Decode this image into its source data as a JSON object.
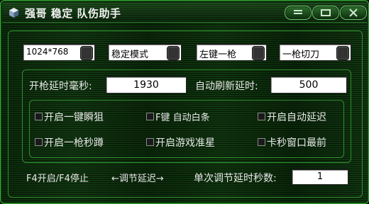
{
  "window": {
    "title": "强哥 稳定 队伤助手",
    "buttons": [
      "menu-icon",
      "minimize-icon",
      "close-icon"
    ]
  },
  "dropdowns": [
    {
      "value": "1024*768"
    },
    {
      "value": "稳定模式"
    },
    {
      "value": "左键一枪"
    },
    {
      "value": "一枪切刀"
    }
  ],
  "settings": {
    "fire_delay_label": "开枪延时毫秒:",
    "fire_delay_value": "1930",
    "refresh_delay_label": "自动刷新延时:",
    "refresh_delay_value": "500"
  },
  "options": [
    {
      "label": "开启一键瞬狙",
      "checked": false
    },
    {
      "label": "F键 自动白条",
      "checked": false
    },
    {
      "label": "开启自动延迟",
      "checked": false
    },
    {
      "label": "开启一枪秒蹲",
      "checked": false
    },
    {
      "label": "开启游戏准星",
      "checked": false
    },
    {
      "label": "卡秒窗口最前",
      "checked": false
    }
  ],
  "footer": {
    "hotkey_text": "F4开启/F4停止",
    "adjust_text": "←调节延迟→",
    "step_label": "单次调节延时秒数:",
    "step_value": "1"
  },
  "colors": {
    "accent": "#3aa83a",
    "background": "#0c2c0c",
    "text": "#e8e8e8"
  }
}
